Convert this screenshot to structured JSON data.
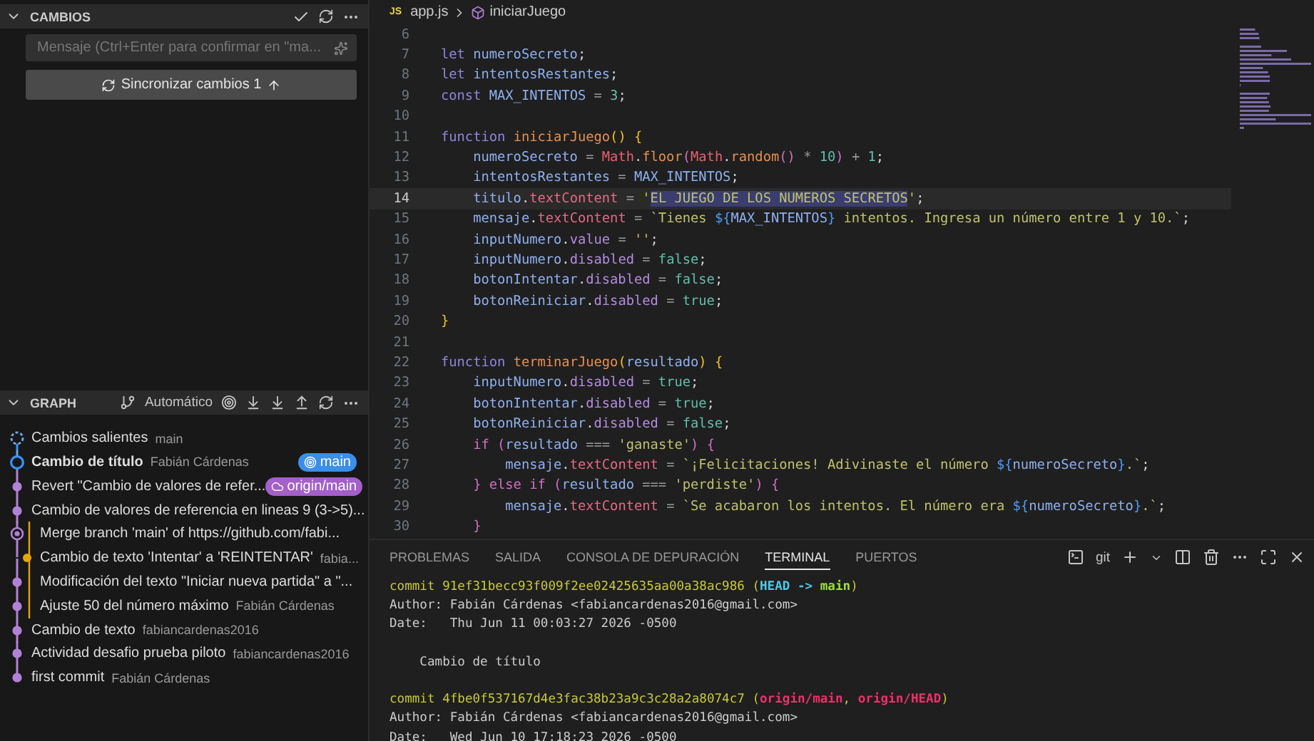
{
  "changes": {
    "title": "CAMBIOS",
    "message": {
      "placeholder": "Mensaje (Ctrl+Enter para confirmar en \"ma..."
    },
    "sync_button": "Sincronizar cambios 1"
  },
  "graph": {
    "title": "GRAPH",
    "mode": "Automático",
    "commits": [
      {
        "kind": "outgoing",
        "message": "Cambios salientes",
        "author": "main",
        "bold": false,
        "side_lane": false
      },
      {
        "kind": "current",
        "message": "Cambio de título",
        "author": "Fabián Cárdenas",
        "bold": true,
        "side_lane": false,
        "refs": [
          {
            "label": "main",
            "kind": "local"
          }
        ]
      },
      {
        "kind": "commit",
        "message": "Revert \"Cambio de valores de refer...",
        "bold": false,
        "side_lane": false,
        "refs": [
          {
            "label": "origin/main",
            "kind": "remote"
          }
        ]
      },
      {
        "kind": "commit",
        "message": "Cambio de valores de referencia en lineas 9 (3->5)...",
        "bold": false,
        "side_lane": false
      },
      {
        "kind": "merge",
        "message": "Merge branch 'main' of https://github.com/fabi...",
        "bold": false,
        "side_lane": true
      },
      {
        "kind": "branch",
        "message": "Cambio de texto 'Intentar' a 'REINTENTAR'",
        "author": "fabia...",
        "bold": false,
        "side_lane": true
      },
      {
        "kind": "commit",
        "message": "Modificación del texto \"Iniciar nueva partida\" a \"...",
        "bold": false,
        "side_lane": true
      },
      {
        "kind": "commit",
        "message": "Ajuste 50 del número máximo",
        "author": "Fabián Cárdenas",
        "bold": false,
        "side_lane": true
      },
      {
        "kind": "commit",
        "message": "Cambio de texto",
        "author": "fabiancardenas2016",
        "bold": false,
        "side_lane": false
      },
      {
        "kind": "commit",
        "message": "Actividad desafio prueba piloto",
        "author": "fabiancardenas2016",
        "bold": false,
        "side_lane": false
      },
      {
        "kind": "commit",
        "message": "first commit",
        "author": "Fabián Cárdenas",
        "bold": false,
        "side_lane": false
      }
    ]
  },
  "breadcrumb": {
    "file_icon": "JS",
    "file": "app.js",
    "symbol": "iniciarJuego"
  },
  "code": [
    {
      "number": "6",
      "current": false
    },
    {
      "number": "7",
      "current": false,
      "tokens": [
        {
          "kind": "kw",
          "text": "let "
        },
        {
          "kind": "var",
          "text": "numeroSecreto"
        },
        {
          "kind": "punct",
          "text": ";"
        }
      ]
    },
    {
      "number": "8",
      "current": false,
      "tokens": [
        {
          "kind": "kw",
          "text": "let "
        },
        {
          "kind": "var",
          "text": "intentosRestantes"
        },
        {
          "kind": "punct",
          "text": ";"
        }
      ]
    },
    {
      "number": "9",
      "current": false,
      "tokens": [
        {
          "kind": "kw",
          "text": "const "
        },
        {
          "kind": "var",
          "text": "MAX_INTENTOS"
        },
        {
          "kind": "op",
          "text": " = "
        },
        {
          "kind": "num",
          "text": "3"
        },
        {
          "kind": "punct",
          "text": ";"
        }
      ]
    },
    {
      "number": "10",
      "current": false
    },
    {
      "number": "11",
      "current": false,
      "tokens": [
        {
          "kind": "kw",
          "text": "function "
        },
        {
          "kind": "func",
          "text": "iniciarJuego"
        },
        {
          "kind": "brace",
          "text": "() {"
        }
      ]
    },
    {
      "number": "12",
      "current": false,
      "tokens": [
        {
          "kind": "var",
          "text": "    numeroSecreto"
        },
        {
          "kind": "op",
          "text": " = "
        },
        {
          "kind": "obj",
          "text": "Math"
        },
        {
          "kind": "punct",
          "text": "."
        },
        {
          "kind": "func",
          "text": "floor"
        },
        {
          "kind": "paren",
          "text": "("
        },
        {
          "kind": "obj",
          "text": "Math"
        },
        {
          "kind": "punct",
          "text": "."
        },
        {
          "kind": "func",
          "text": "random"
        },
        {
          "kind": "brace2",
          "text": "()"
        },
        {
          "kind": "op",
          "text": " * "
        },
        {
          "kind": "num",
          "text": "10"
        },
        {
          "kind": "paren",
          "text": ")"
        },
        {
          "kind": "op",
          "text": " + "
        },
        {
          "kind": "num",
          "text": "1"
        },
        {
          "kind": "punct",
          "text": ";"
        }
      ]
    },
    {
      "number": "13",
      "current": false,
      "tokens": [
        {
          "kind": "var",
          "text": "    intentosRestantes"
        },
        {
          "kind": "op",
          "text": " = "
        },
        {
          "kind": "var",
          "text": "MAX_INTENTOS"
        },
        {
          "kind": "punct",
          "text": ";"
        }
      ]
    },
    {
      "number": "14",
      "current": true,
      "tokens": [
        {
          "kind": "var",
          "text": "    titulo"
        },
        {
          "kind": "punct",
          "text": "."
        },
        {
          "kind": "prop",
          "text": "textContent"
        },
        {
          "kind": "op",
          "text": " = "
        },
        {
          "kind": "str",
          "text": "'"
        },
        {
          "kind": "sel",
          "text": "EL JUEGO DE LOS NUMEROS SECRETOS"
        },
        {
          "kind": "str",
          "text": "'"
        },
        {
          "kind": "punct",
          "text": ";"
        }
      ]
    },
    {
      "number": "15",
      "current": false,
      "tokens": [
        {
          "kind": "var",
          "text": "    mensaje"
        },
        {
          "kind": "punct",
          "text": "."
        },
        {
          "kind": "prop",
          "text": "textContent"
        },
        {
          "kind": "op",
          "text": " = "
        },
        {
          "kind": "str",
          "text": "`Tienes "
        },
        {
          "kind": "tpl",
          "text": "${"
        },
        {
          "kind": "var",
          "text": "MAX_INTENTOS"
        },
        {
          "kind": "tpl",
          "text": "}"
        },
        {
          "kind": "str",
          "text": " intentos. Ingresa un número entre 1 y 10.`"
        },
        {
          "kind": "punct",
          "text": ";"
        }
      ]
    },
    {
      "number": "16",
      "current": false,
      "tokens": [
        {
          "kind": "var",
          "text": "    inputNumero"
        },
        {
          "kind": "punct",
          "text": "."
        },
        {
          "kind": "prop2",
          "text": "value"
        },
        {
          "kind": "op",
          "text": " = "
        },
        {
          "kind": "str",
          "text": "''"
        },
        {
          "kind": "punct",
          "text": ";"
        }
      ]
    },
    {
      "number": "17",
      "current": false,
      "tokens": [
        {
          "kind": "var",
          "text": "    inputNumero"
        },
        {
          "kind": "punct",
          "text": "."
        },
        {
          "kind": "prop2",
          "text": "disabled"
        },
        {
          "kind": "op",
          "text": " = "
        },
        {
          "kind": "num",
          "text": "false"
        },
        {
          "kind": "punct",
          "text": ";"
        }
      ]
    },
    {
      "number": "18",
      "current": false,
      "tokens": [
        {
          "kind": "var",
          "text": "    botonIntentar"
        },
        {
          "kind": "punct",
          "text": "."
        },
        {
          "kind": "prop2",
          "text": "disabled"
        },
        {
          "kind": "op",
          "text": " = "
        },
        {
          "kind": "num",
          "text": "false"
        },
        {
          "kind": "punct",
          "text": ";"
        }
      ]
    },
    {
      "number": "19",
      "current": false,
      "tokens": [
        {
          "kind": "var",
          "text": "    botonReiniciar"
        },
        {
          "kind": "punct",
          "text": "."
        },
        {
          "kind": "prop2",
          "text": "disabled"
        },
        {
          "kind": "op",
          "text": " = "
        },
        {
          "kind": "num",
          "text": "true"
        },
        {
          "kind": "punct",
          "text": ";"
        }
      ]
    },
    {
      "number": "20",
      "current": false,
      "tokens": [
        {
          "kind": "brace",
          "text": "}"
        }
      ]
    },
    {
      "number": "21",
      "current": false
    },
    {
      "number": "22",
      "current": false,
      "tokens": [
        {
          "kind": "kw",
          "text": "function "
        },
        {
          "kind": "func",
          "text": "terminarJuego"
        },
        {
          "kind": "brace",
          "text": "("
        },
        {
          "kind": "var",
          "text": "resultado"
        },
        {
          "kind": "brace",
          "text": ") {"
        }
      ]
    },
    {
      "number": "23",
      "current": false,
      "tokens": [
        {
          "kind": "var",
          "text": "    inputNumero"
        },
        {
          "kind": "punct",
          "text": "."
        },
        {
          "kind": "prop2",
          "text": "disabled"
        },
        {
          "kind": "op",
          "text": " = "
        },
        {
          "kind": "num",
          "text": "true"
        },
        {
          "kind": "punct",
          "text": ";"
        }
      ]
    },
    {
      "number": "24",
      "current": false,
      "tokens": [
        {
          "kind": "var",
          "text": "    botonIntentar"
        },
        {
          "kind": "punct",
          "text": "."
        },
        {
          "kind": "prop2",
          "text": "disabled"
        },
        {
          "kind": "op",
          "text": " = "
        },
        {
          "kind": "num",
          "text": "true"
        },
        {
          "kind": "punct",
          "text": ";"
        }
      ]
    },
    {
      "number": "25",
      "current": false,
      "tokens": [
        {
          "kind": "var",
          "text": "    botonReiniciar"
        },
        {
          "kind": "punct",
          "text": "."
        },
        {
          "kind": "prop2",
          "text": "disabled"
        },
        {
          "kind": "op",
          "text": " = "
        },
        {
          "kind": "num",
          "text": "false"
        },
        {
          "kind": "punct",
          "text": ";"
        }
      ]
    },
    {
      "number": "26",
      "current": false,
      "tokens": [
        {
          "kind": "ctrl",
          "text": "    if "
        },
        {
          "kind": "paren",
          "text": "("
        },
        {
          "kind": "var",
          "text": "resultado"
        },
        {
          "kind": "op",
          "text": " === "
        },
        {
          "kind": "str",
          "text": "'ganaste'"
        },
        {
          "kind": "paren",
          "text": ") {"
        }
      ]
    },
    {
      "number": "27",
      "current": false,
      "tokens": [
        {
          "kind": "var",
          "text": "        mensaje"
        },
        {
          "kind": "punct",
          "text": "."
        },
        {
          "kind": "prop",
          "text": "textContent"
        },
        {
          "kind": "op",
          "text": " = "
        },
        {
          "kind": "str",
          "text": "`¡Felicitaciones! Adivinaste el número "
        },
        {
          "kind": "tpl",
          "text": "${"
        },
        {
          "kind": "var",
          "text": "numeroSecreto"
        },
        {
          "kind": "tpl",
          "text": "}"
        },
        {
          "kind": "str",
          "text": ".`"
        },
        {
          "kind": "punct",
          "text": ";"
        }
      ]
    },
    {
      "number": "28",
      "current": false,
      "tokens": [
        {
          "kind": "paren",
          "text": "    } "
        },
        {
          "kind": "ctrl",
          "text": "else if "
        },
        {
          "kind": "paren",
          "text": "("
        },
        {
          "kind": "var",
          "text": "resultado"
        },
        {
          "kind": "op",
          "text": " === "
        },
        {
          "kind": "str",
          "text": "'perdiste'"
        },
        {
          "kind": "paren",
          "text": ") {"
        }
      ]
    },
    {
      "number": "29",
      "current": false,
      "tokens": [
        {
          "kind": "var",
          "text": "        mensaje"
        },
        {
          "kind": "punct",
          "text": "."
        },
        {
          "kind": "prop",
          "text": "textContent"
        },
        {
          "kind": "op",
          "text": " = "
        },
        {
          "kind": "str",
          "text": "`Se acabaron los intentos. El número era "
        },
        {
          "kind": "tpl",
          "text": "${"
        },
        {
          "kind": "var",
          "text": "numeroSecreto"
        },
        {
          "kind": "tpl",
          "text": "}"
        },
        {
          "kind": "str",
          "text": ".`"
        },
        {
          "kind": "punct",
          "text": ";"
        }
      ]
    },
    {
      "number": "30",
      "current": false,
      "tokens": [
        {
          "kind": "paren",
          "text": "    }"
        }
      ]
    }
  ],
  "panel": {
    "tabs": [
      {
        "label": "PROBLEMAS",
        "selected": false
      },
      {
        "label": "SALIDA",
        "selected": false
      },
      {
        "label": "CONSOLA DE DEPURACIÓN",
        "selected": false
      },
      {
        "label": "TERMINAL",
        "selected": true
      },
      {
        "label": "PUERTOS",
        "selected": false
      }
    ],
    "shell": "git",
    "terminal": [
      {
        "blank_before": false,
        "tokens": [
          {
            "kind": "commit",
            "text": "commit 91ef31becc93f009f2ee02425635aa00a38ac986 ("
          },
          {
            "kind": "head",
            "text": "HEAD -> "
          },
          {
            "kind": "branch",
            "text": "main"
          },
          {
            "kind": "commit",
            "text": ")"
          }
        ]
      },
      {
        "blank_before": false,
        "tokens": [
          {
            "kind": "plain",
            "text": "Author: Fabián Cárdenas <fabiancardenas2016@gmail.com>"
          }
        ]
      },
      {
        "blank_before": false,
        "tokens": [
          {
            "kind": "plain",
            "text": "Date:   Thu Jun 11 00:03:27 2026 -0500"
          }
        ]
      },
      {
        "blank_before": true,
        "tokens": [
          {
            "kind": "plain",
            "text": "    Cambio de título"
          }
        ]
      },
      {
        "blank_before": true,
        "tokens": [
          {
            "kind": "commit",
            "text": "commit 4fbe0f537167d4e3fac38b23a9c3c28a2a8074c7 ("
          },
          {
            "kind": "remote",
            "text": "origin/main"
          },
          {
            "kind": "commit",
            "text": ", "
          },
          {
            "kind": "remote",
            "text": "origin/HEAD"
          },
          {
            "kind": "commit",
            "text": ")"
          }
        ]
      },
      {
        "blank_before": false,
        "tokens": [
          {
            "kind": "plain",
            "text": "Author: Fabián Cárdenas <fabiancardenas2016@gmail.com>"
          }
        ]
      },
      {
        "blank_before": false,
        "tokens": [
          {
            "kind": "plain",
            "text": "Date:   Wed Jun 10 17:18:23 2026 -0500"
          }
        ]
      }
    ]
  }
}
